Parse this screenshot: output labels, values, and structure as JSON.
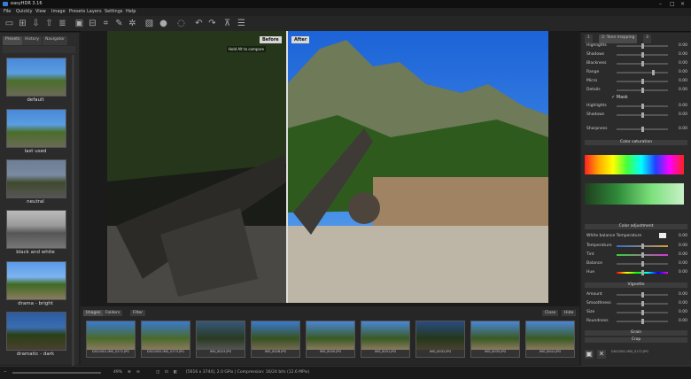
{
  "window": {
    "title": "easyHDR 3.16"
  },
  "menu": [
    "File",
    "Quickly",
    "View",
    "Image",
    "Presets",
    "Layers",
    "Settings",
    "Help"
  ],
  "left": {
    "tabs": [
      "Presets",
      "History",
      "Navigator"
    ],
    "presets": [
      "default",
      "last used",
      "neutral",
      "black and white",
      "drama - bright",
      "dramatic - dark"
    ]
  },
  "viewer": {
    "before": "Before",
    "after": "After",
    "hint": "Hold Alt to compare"
  },
  "filmstrip": {
    "tabs": [
      "Images",
      "Folders",
      "Filter"
    ],
    "buttons": [
      "Close",
      "Hide"
    ],
    "captions": [
      "DSC0001-IMG_0172.JPG",
      "DSC0002-IMG_0173.JPG",
      "IMG_8023.JPG",
      "IMG_8026.JPG",
      "IMG_8030.JPG",
      "IMG_8031.JPG",
      "IMG_8032.JPG",
      "IMG_8035.JPG",
      "IMG_8041.JPG"
    ]
  },
  "status": {
    "zoom": "49%",
    "info": "[5616 x 3744], 2.0 GPix  |  Compression: 16/24 bits (12.6 MPix)"
  },
  "right": {
    "tabs": [
      "1",
      "2: Tone mapping",
      "3"
    ],
    "tone": [
      {
        "label": "Highlights",
        "value": "0.00"
      },
      {
        "label": "Shadows",
        "value": "0.00"
      },
      {
        "label": "Blackness",
        "value": "0.00"
      },
      {
        "label": "Range",
        "value": "0.00"
      },
      {
        "label": "Micro",
        "value": "0.00"
      },
      {
        "label": "Details",
        "value": "0.00"
      }
    ],
    "check": "Mask",
    "tone2": [
      {
        "label": "Highlights",
        "value": "0.00"
      },
      {
        "label": "Shadows",
        "value": "0.00"
      },
      {
        "label": "Sharpness",
        "value": "0.00"
      }
    ],
    "sections": [
      "Color saturation",
      "Color adjustment",
      "Vignette",
      "Grain",
      "Crop"
    ],
    "wb": [
      {
        "label": "White balance Temperature",
        "value": "0.00"
      },
      {
        "label": "Temperature",
        "value": "0.00"
      },
      {
        "label": "Tint",
        "value": "0.00"
      },
      {
        "label": "Balance",
        "value": "0.00"
      },
      {
        "label": "Hue",
        "value": "0.00"
      }
    ],
    "vig": [
      {
        "label": "Amount",
        "value": "0.00"
      },
      {
        "label": "Smoothness",
        "value": "0.00"
      },
      {
        "label": "Size",
        "value": "0.00"
      },
      {
        "label": "Roundness",
        "value": "0.00"
      }
    ],
    "footer": "DSC0001-IMG_0172.JPG"
  }
}
